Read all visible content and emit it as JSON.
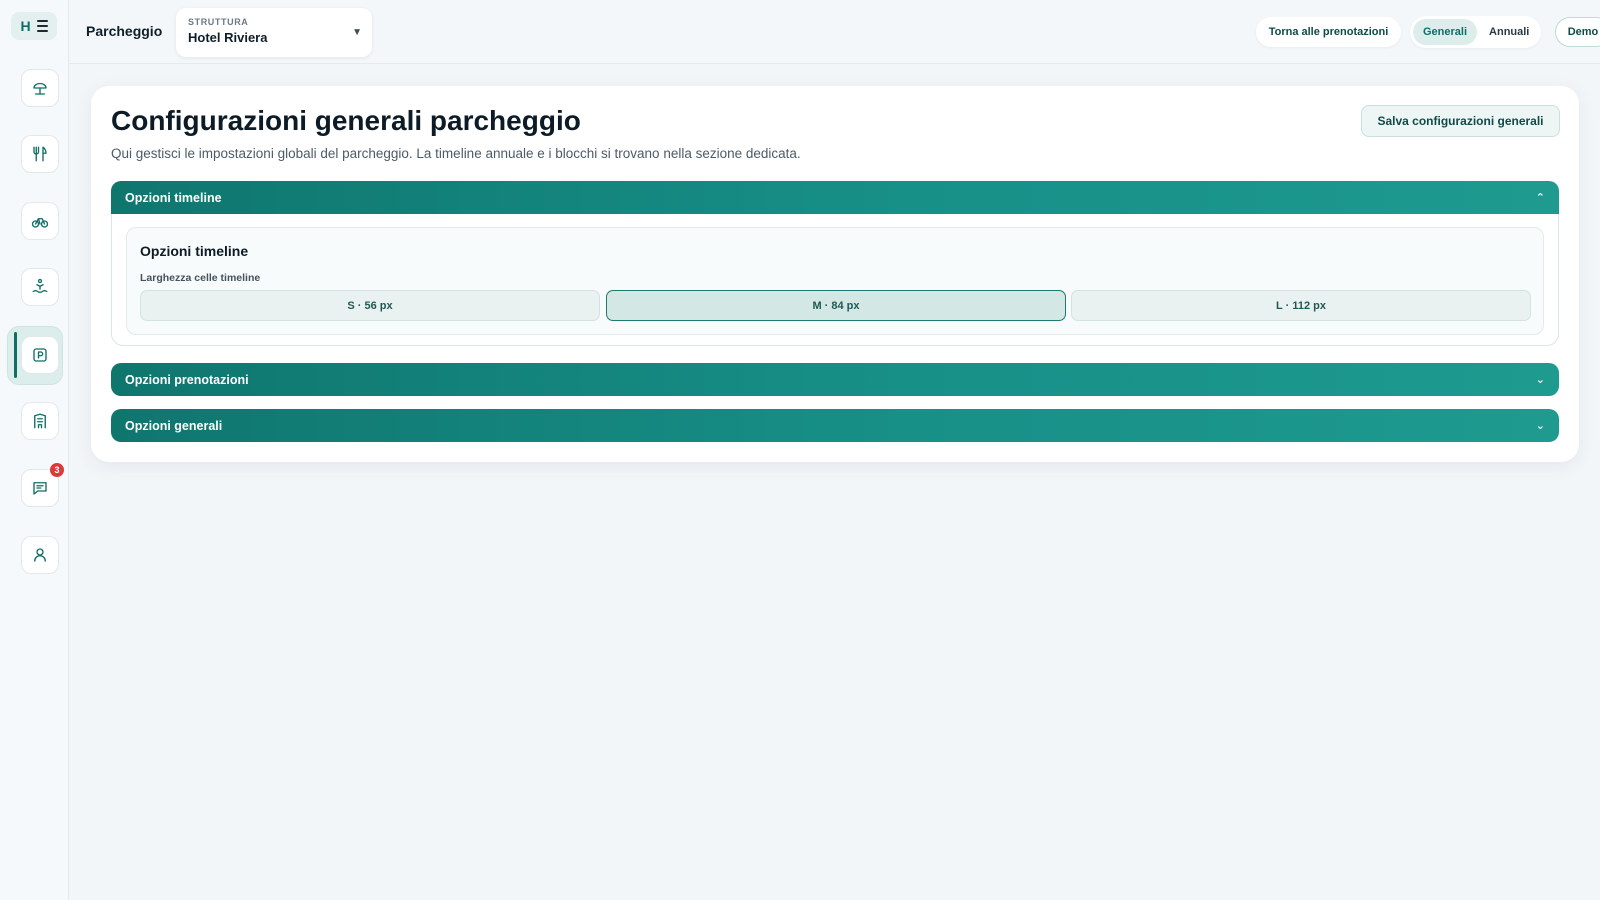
{
  "sidebar": {
    "logo_letter": "H",
    "items": [
      {
        "name": "beach-icon"
      },
      {
        "name": "restaurant-icon"
      },
      {
        "name": "bike-icon"
      },
      {
        "name": "pool-icon"
      },
      {
        "name": "parking-icon",
        "active": true
      },
      {
        "name": "hotel-icon"
      },
      {
        "name": "chat-icon",
        "badge": "3"
      },
      {
        "name": "user-icon"
      }
    ]
  },
  "topbar": {
    "page_label": "Parcheggio",
    "struttura": {
      "caption": "STRUTTURA",
      "value": "Hotel Riviera"
    },
    "back_label": "Torna alle prenotazioni",
    "segment": {
      "options": [
        "Generali",
        "Annuali"
      ],
      "selected": "Generali"
    },
    "demo_label": "Demo"
  },
  "main": {
    "title": "Configurazioni generali parcheggio",
    "subtitle": "Qui gestisci le impostazioni globali del parcheggio. La timeline annuale e i blocchi si trovano nella sezione dedicata.",
    "save_label": "Salva configurazioni generali",
    "sections": [
      {
        "title": "Opzioni timeline",
        "expanded": true,
        "panel_title": "Opzioni timeline",
        "field_label": "Larghezza celle timeline",
        "options": [
          "S · 56 px",
          "M · 84 px",
          "L · 112 px"
        ],
        "selected": "M · 84 px"
      },
      {
        "title": "Opzioni prenotazioni",
        "expanded": false
      },
      {
        "title": "Opzioni generali",
        "expanded": false
      }
    ]
  },
  "colors": {
    "accent": "#0f766e",
    "badge": "#d93a3a"
  }
}
